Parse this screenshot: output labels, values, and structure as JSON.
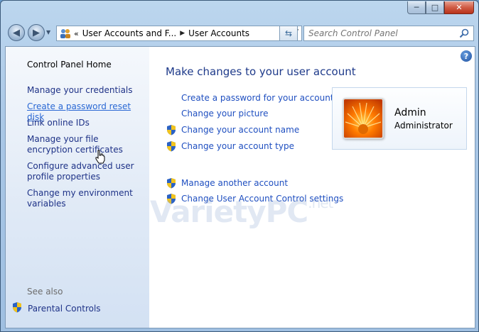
{
  "window": {
    "caption": {
      "minimize": "─",
      "maximize": "□",
      "close": "✕"
    }
  },
  "nav": {
    "back_icon": "back-arrow-icon",
    "forward_icon": "forward-arrow-icon",
    "breadcrumb": [
      "User Accounts and F...",
      "User Accounts"
    ],
    "search_placeholder": "Search Control Panel"
  },
  "sidebar": {
    "home": "Control Panel Home",
    "items": [
      "Manage your credentials",
      "Create a password reset disk",
      "Link online IDs",
      "Manage your file encryption certificates",
      "Configure advanced user profile properties",
      "Change my environment variables"
    ],
    "see_also_label": "See also",
    "see_also_items": [
      "Parental Controls"
    ]
  },
  "main": {
    "title": "Make changes to your user account",
    "tasks": [
      {
        "label": "Create a password for your account",
        "shield": false
      },
      {
        "label": "Change your picture",
        "shield": false
      },
      {
        "label": "Change your account name",
        "shield": true
      },
      {
        "label": "Change your account type",
        "shield": true
      },
      {
        "label": "Manage another account",
        "shield": true
      },
      {
        "label": "Change User Account Control settings",
        "shield": true
      }
    ],
    "help_label": "?"
  },
  "account": {
    "name": "Admin",
    "role": "Administrator"
  },
  "watermark": {
    "text": "VarietyPC",
    "suffix": ".net"
  },
  "colors": {
    "link": "#1f4fc0",
    "title": "#1e3a8a",
    "sidebar_link": "#1e3287"
  }
}
